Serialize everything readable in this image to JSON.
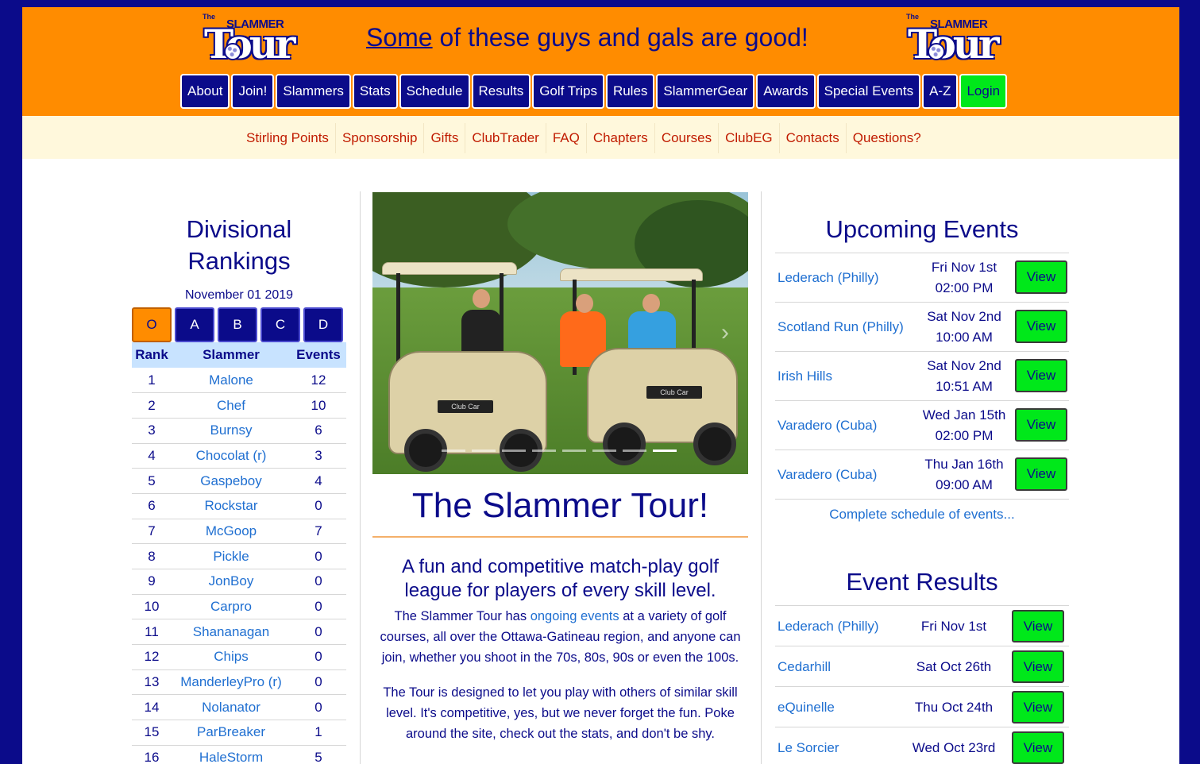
{
  "logo": {
    "the": "The",
    "slammer": "SLAMMER",
    "tour": "Tour"
  },
  "header": {
    "tagline_lead": "Some",
    "tagline_rest": " of these guys and gals are good!"
  },
  "main_nav": [
    "About",
    "Join!",
    "Slammers",
    "Stats",
    "Schedule",
    "Results",
    "Golf Trips",
    "Rules",
    "SlammerGear",
    "Awards",
    "Special Events",
    "A-Z",
    "Login"
  ],
  "sub_nav": [
    "Stirling Points",
    "Sponsorship",
    "Gifts",
    "ClubTrader",
    "FAQ",
    "Chapters",
    "Courses",
    "ClubEG",
    "Contacts",
    "Questions?"
  ],
  "rankings": {
    "title_line1": "Divisional",
    "title_line2": "Rankings",
    "date": "November 01 2019",
    "divisions": [
      "O",
      "A",
      "B",
      "C",
      "D"
    ],
    "active_division": "O",
    "columns": [
      "Rank",
      "Slammer",
      "Events"
    ],
    "rows": [
      {
        "rank": "1",
        "name": "Malone",
        "events": "12"
      },
      {
        "rank": "2",
        "name": "Chef",
        "events": "10"
      },
      {
        "rank": "3",
        "name": "Burnsy",
        "events": "6"
      },
      {
        "rank": "4",
        "name": "Chocolat (r)",
        "events": "3"
      },
      {
        "rank": "5",
        "name": "Gaspeboy",
        "events": "4"
      },
      {
        "rank": "6",
        "name": "Rockstar",
        "events": "0"
      },
      {
        "rank": "7",
        "name": "McGoop",
        "events": "7"
      },
      {
        "rank": "8",
        "name": "Pickle",
        "events": "0"
      },
      {
        "rank": "9",
        "name": "JonBoy",
        "events": "0"
      },
      {
        "rank": "10",
        "name": "Carpro",
        "events": "0"
      },
      {
        "rank": "11",
        "name": "Shananagan",
        "events": "0"
      },
      {
        "rank": "12",
        "name": "Chips",
        "events": "0"
      },
      {
        "rank": "13",
        "name": "ManderleyPro (r)",
        "events": "0"
      },
      {
        "rank": "14",
        "name": "Nolanator",
        "events": "0"
      },
      {
        "rank": "15",
        "name": "ParBreaker",
        "events": "1"
      },
      {
        "rank": "16",
        "name": "HaleStorm",
        "events": "5"
      }
    ]
  },
  "carousel": {
    "slide_count": 8,
    "active_slide": 8,
    "cart_plate": "Club Car"
  },
  "intro": {
    "title": "The Slammer Tour!",
    "lead": "A fun and competitive match-play golf league for players of every skill level.",
    "p1_before": "The Slammer Tour has ",
    "p1_link": "ongoing events",
    "p1_after": " at a variety of golf courses, all over the Ottawa-Gatineau region, and anyone can join, whether you shoot in the 70s, 80s, 90s or even the 100s.",
    "p2": "The Tour is designed to let you play with others of similar skill level. It's competitive, yes, but we never forget the fun. Poke around the site, check out the stats, and don't be shy."
  },
  "upcoming": {
    "title": "Upcoming Events",
    "view_label": "View",
    "events": [
      {
        "name": "Lederach (Philly)",
        "date": "Fri Nov 1st",
        "time": "02:00 PM"
      },
      {
        "name": "Scotland Run (Philly)",
        "date": "Sat Nov 2nd",
        "time": "10:00 AM"
      },
      {
        "name": "Irish Hills",
        "date": "Sat Nov 2nd",
        "time": "10:51 AM"
      },
      {
        "name": "Varadero (Cuba)",
        "date": "Wed Jan 15th",
        "time": "02:00 PM"
      },
      {
        "name": "Varadero (Cuba)",
        "date": "Thu Jan 16th",
        "time": "09:00 AM"
      }
    ],
    "complete_link": "Complete schedule of events..."
  },
  "results": {
    "title": "Event Results",
    "view_label": "View",
    "events": [
      {
        "name": "Lederach (Philly)",
        "date": "Fri Nov 1st"
      },
      {
        "name": "Cedarhill",
        "date": "Sat Oct 26th"
      },
      {
        "name": "eQuinelle",
        "date": "Thu Oct 24th"
      },
      {
        "name": "Le Sorcier",
        "date": "Wed Oct 23rd"
      }
    ]
  },
  "colors": {
    "page_border": "#0b0b8a",
    "header_bg": "#ff8c00",
    "nav_button": "#0b0b8a",
    "login_button": "#00e81a",
    "subnav_bg": "#fff8dc",
    "link": "#1f6fd1"
  }
}
